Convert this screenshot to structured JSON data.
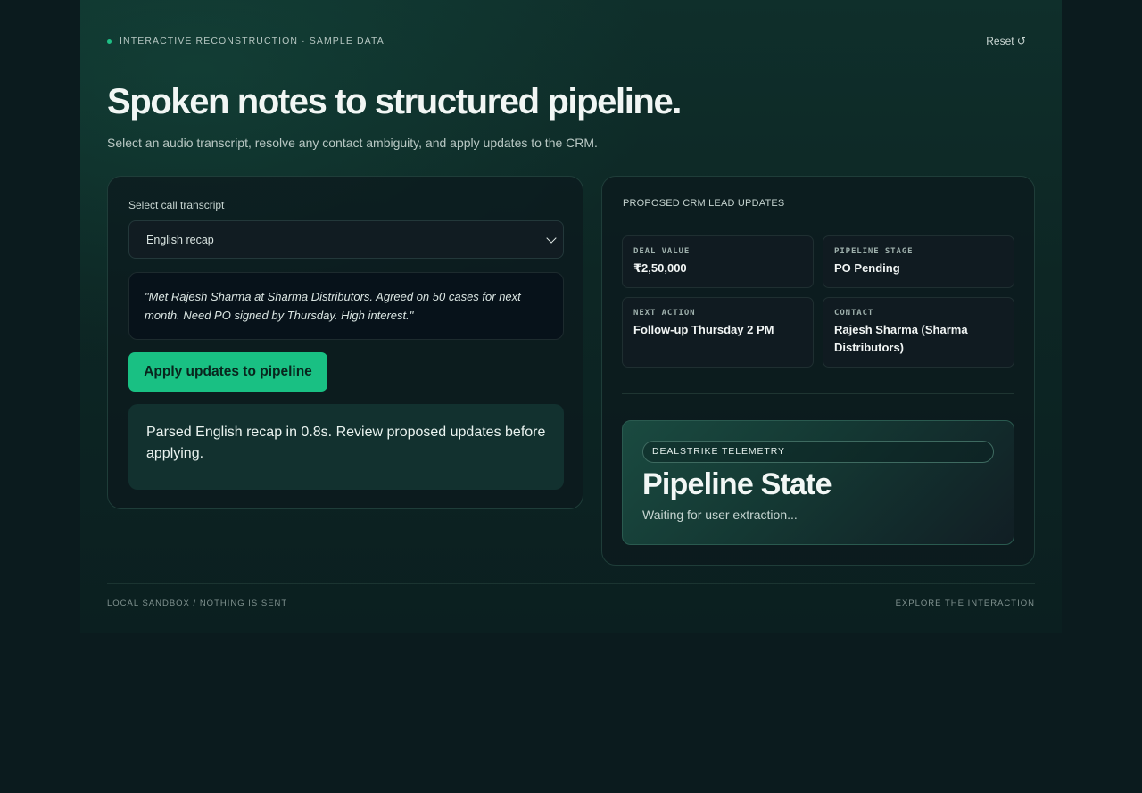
{
  "header": {
    "eyebrow": "INTERACTIVE RECONSTRUCTION · SAMPLE DATA",
    "reset_label": "Reset ↺",
    "title": "Spoken notes to structured pipeline.",
    "subtitle": "Select an audio transcript, resolve any contact ambiguity, and apply updates to the CRM."
  },
  "input_panel": {
    "select_label": "Select call transcript",
    "selected_transcript": "English recap",
    "transcript_text": "\"Met Rajesh Sharma at Sharma Distributors. Agreed on 50 cases for next month. Need PO signed by Thursday. High interest.\"",
    "apply_button": "Apply updates to pipeline",
    "status_message": "Parsed English recap in 0.8s. Review proposed updates before applying."
  },
  "updates_panel": {
    "title": "PROPOSED CRM LEAD UPDATES",
    "fields": [
      {
        "label": "DEAL VALUE",
        "value": "₹2,50,000"
      },
      {
        "label": "PIPELINE STAGE",
        "value": "PO Pending"
      },
      {
        "label": "NEXT ACTION",
        "value": "Follow-up Thursday 2 PM"
      },
      {
        "label": "CONTACT",
        "value": "Rajesh Sharma (Sharma Distributors)"
      }
    ],
    "telemetry": {
      "badge": "DEALSTRIKE TELEMETRY",
      "title": "Pipeline State",
      "subtitle": "Waiting for user extraction..."
    }
  },
  "footer": {
    "left": "LOCAL SANDBOX / NOTHING IS SENT",
    "right": "EXPLORE THE INTERACTION"
  },
  "colors": {
    "accent": "#19c083",
    "background": "#0b1b1e"
  }
}
